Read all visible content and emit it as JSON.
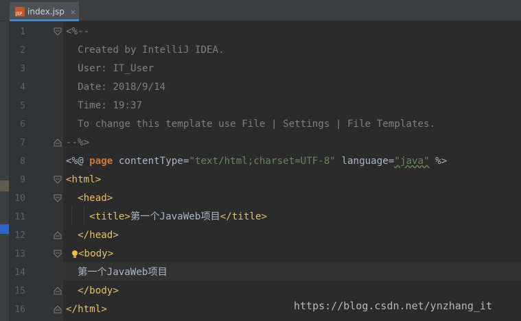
{
  "tab": {
    "title": "index.jsp",
    "icon_label": "JSP",
    "close": "×"
  },
  "lines": [
    {
      "n": "1",
      "parts": [
        {
          "t": "<%--"
        }
      ]
    },
    {
      "n": "2",
      "parts": [
        {
          "t": "  Created by IntelliJ IDEA."
        }
      ]
    },
    {
      "n": "3",
      "parts": [
        {
          "t": "  User: IT_User"
        }
      ]
    },
    {
      "n": "4",
      "parts": [
        {
          "t": "  Date: 2018/9/14"
        }
      ]
    },
    {
      "n": "5",
      "parts": [
        {
          "t": "  Time: 19:37"
        }
      ]
    },
    {
      "n": "6",
      "parts": [
        {
          "t": "  To change this template use File | Settings | File Templates."
        }
      ]
    },
    {
      "n": "7",
      "parts": [
        {
          "t": "--%>"
        }
      ]
    },
    {
      "n": "8",
      "parts": [
        {
          "t": "<%@ "
        },
        {
          "t": "page"
        },
        {
          "t": " contentType="
        },
        {
          "t": "\"text/html;charset=UTF-8\""
        },
        {
          "t": " language="
        },
        {
          "t": "\"java\""
        },
        {
          "t": " %>"
        }
      ]
    },
    {
      "n": "9",
      "parts": [
        {
          "t": "<html>"
        }
      ]
    },
    {
      "n": "10",
      "parts": [
        {
          "t": "  <head>"
        }
      ]
    },
    {
      "n": "11",
      "parts": [
        {
          "t": "    <title>"
        },
        {
          "t": "第一个JavaWeb项目"
        },
        {
          "t": "</title>"
        }
      ]
    },
    {
      "n": "12",
      "parts": [
        {
          "t": "  </head>"
        }
      ]
    },
    {
      "n": "13",
      "parts": [
        {
          "t": "<body>"
        }
      ]
    },
    {
      "n": "14",
      "parts": [
        {
          "t": "  第一个JavaWeb项目"
        }
      ]
    },
    {
      "n": "15",
      "parts": [
        {
          "t": "  </body>"
        }
      ]
    },
    {
      "n": "16",
      "parts": [
        {
          "t": "</html>"
        }
      ]
    }
  ],
  "watermark": "https://blog.csdn.net/ynzhang_it",
  "colors": {
    "background": "#2b2b2b",
    "gutter": "#313335",
    "comment": "#808080",
    "tag": "#e8bf6a",
    "keyword": "#cc7832",
    "string": "#6a8759",
    "text": "#a9b7c6",
    "tab_accent": "#4a88c7"
  }
}
